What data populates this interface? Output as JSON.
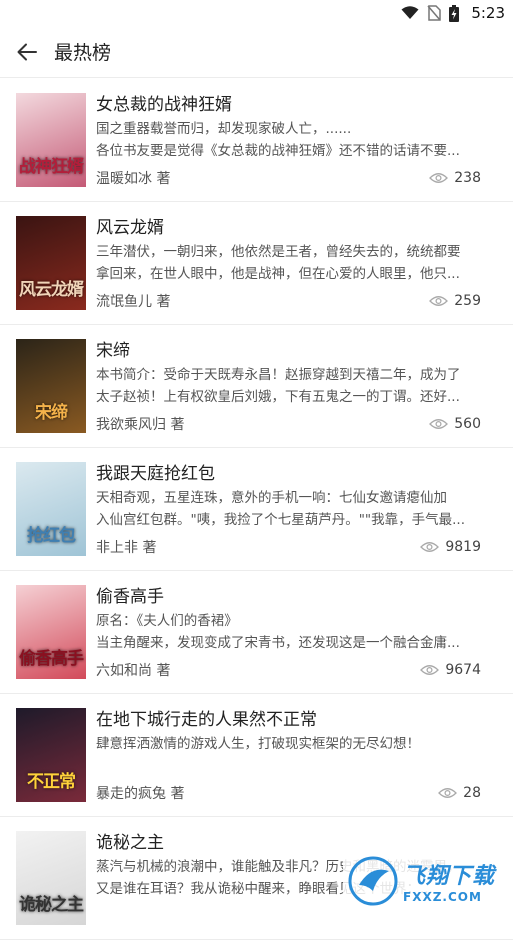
{
  "status_bar": {
    "time": "5:23"
  },
  "toolbar": {
    "title": "最热榜"
  },
  "books": [
    {
      "title": "女总裁的战神狂婿",
      "desc1": "国之重器载誉而归，却发现家破人亡，......",
      "desc2": "各位书友要是觉得《女总裁的战神狂婿》还不错的话请不要...",
      "author": "温暖如冰 著",
      "views": "238",
      "cover_text": "战神狂婿",
      "cover_bg": "#f3d9de",
      "cover_bg2": "#c45a76",
      "cover_fg": "#b21e3a"
    },
    {
      "title": "风云龙婿",
      "desc1": "三年潜伏，一朝归来，他依然是王者，曾经失去的，统统都要",
      "desc2": "拿回来，在世人眼中，他是战神，但在心爱的人眼里，他只...",
      "author": "流氓鱼儿 著",
      "views": "259",
      "cover_text": "风云龙婿",
      "cover_bg": "#3a1412",
      "cover_bg2": "#8a2a1e",
      "cover_fg": "#f0d4b8"
    },
    {
      "title": "宋缔",
      "desc1": "本书简介：受命于天既寿永昌！赵振穿越到天禧二年，成为了",
      "desc2": "太子赵祯！上有权欲皇后刘娥，下有五鬼之一的丁谓。还好...",
      "author": "我欲乘风归 著",
      "views": "560",
      "cover_text": "宋缔",
      "cover_bg": "#2b2418",
      "cover_bg2": "#8a5a22",
      "cover_fg": "#f4b24a"
    },
    {
      "title": "我跟天庭抢红包",
      "desc1": "天相奇观，五星连珠，意外的手机一响：七仙女邀请瘪仙加",
      "desc2": "入仙宫红包群。\"咦，我捡了个七星葫芦丹。\"\"我靠，手气最...",
      "author": "非上非 著",
      "views": "9819",
      "cover_text": "抢红包",
      "cover_bg": "#dbe9ef",
      "cover_bg2": "#9fc4d6",
      "cover_fg": "#3f7fb2"
    },
    {
      "title": "偷香高手",
      "desc1": "原名：《夫人们的香裙》",
      "desc2": "当主角醒来，发现变成了宋青书，还发现这是一个融合金庸...",
      "author": "六如和尚 著",
      "views": "9674",
      "cover_text": "偷香高手",
      "cover_bg": "#f5d0d4",
      "cover_bg2": "#d24a5a",
      "cover_fg": "#8a1020"
    },
    {
      "title": "在地下城行走的人果然不正常",
      "desc1": "肆意挥洒激情的游戏人生，打破现实框架的无尽幻想！",
      "desc2": "",
      "author": "暴走的疯兔 著",
      "views": "28",
      "cover_text": "不正常",
      "cover_bg": "#1e1a2a",
      "cover_bg2": "#7a2a3a",
      "cover_fg": "#ffd23a"
    },
    {
      "title": "诡秘之主",
      "desc1": "蒸汽与机械的浪潮中，谁能触及非凡？历史和黑暗的迷雾里，",
      "desc2": "又是谁在耳语？我从诡秘中醒来，睁眼看见这个世界：...",
      "author": "",
      "views": "",
      "cover_text": "诡秘之主",
      "cover_bg": "#f2f2f2",
      "cover_bg2": "#d6d6d6",
      "cover_fg": "#333333"
    }
  ],
  "watermark": {
    "title": "飞翔下载",
    "url": "FXXZ.COM"
  },
  "colors": {
    "divider": "#ececec",
    "accent": "#2a8dd8"
  }
}
